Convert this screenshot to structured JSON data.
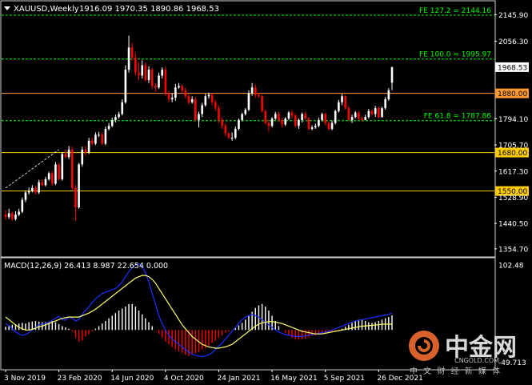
{
  "header": {
    "symbol_timeframe": "XAUUSD,Weekly",
    "ohlc": "1916.09 1970.35 1890.86 1968.53",
    "menu_icon": "triangle-down-icon"
  },
  "colors": {
    "background": "#000000",
    "bull": "#ffffff",
    "bear": "#ff0000",
    "fib": "#00ff00",
    "level_orange": "#ff9933",
    "level_yellow": "#ffcc00",
    "macd_line": "#1e2fff",
    "signal_line": "#ffff66",
    "axis": "#ffffff"
  },
  "chart_data": [
    {
      "type": "candlestick",
      "title": "XAUUSD,Weekly",
      "ylim": [
        1330,
        2190
      ],
      "y_ticks": [
        "2145.90",
        "2056.30",
        "1968.53",
        "1880.00",
        "1794.10",
        "1705.70",
        "1617.30",
        "1528.90",
        "1440.50",
        "1354.70"
      ],
      "last_price": "1968.53",
      "x_tick_labels": [
        "3 Nov 2019",
        "23 Feb 2020",
        "14 Jun 2020",
        "4 Oct 2020",
        "24 Jan 2021",
        "16 May 2021",
        "5 Sep 2021",
        "26 Dec 2021"
      ],
      "x_tick_index": [
        0,
        16,
        32,
        48,
        64,
        80,
        96,
        112
      ],
      "lines": [
        {
          "label": "FE 127.2 = 2144.16",
          "value": 2144.16,
          "style": "dashed",
          "color": "fib"
        },
        {
          "label": "FE 100.0 = 1995.97",
          "value": 1995.97,
          "style": "dashed",
          "color": "fib"
        },
        {
          "label": "FE 61.8 = 1787.86",
          "value": 1787.86,
          "style": "dashed",
          "color": "fib"
        },
        {
          "label": "1880.00",
          "value": 1880.0,
          "style": "solid",
          "color": "level_orange"
        },
        {
          "label": "1680.00",
          "value": 1680.0,
          "style": "solid",
          "color": "level_yellow"
        },
        {
          "label": "1550.00",
          "value": 1550.0,
          "style": "solid",
          "color": "level_yellow"
        }
      ],
      "fib_projection": [
        [
          0,
          1560
        ],
        [
          16,
          1690
        ]
      ],
      "close": [
        1462,
        1475,
        1455,
        1470,
        1480,
        1520,
        1545,
        1550,
        1560,
        1545,
        1580,
        1570,
        1590,
        1610,
        1575,
        1640,
        1590,
        1675,
        1665,
        1690,
        1560,
        1495,
        1640,
        1690,
        1680,
        1720,
        1710,
        1740,
        1740,
        1710,
        1760,
        1770,
        1790,
        1800,
        1810,
        1850,
        1960,
        2035,
        2000,
        1950,
        1940,
        1975,
        1925,
        1960,
        1905,
        1900,
        1940,
        1960,
        1880,
        1860,
        1865,
        1900,
        1905,
        1890,
        1870,
        1850,
        1860,
        1790,
        1810,
        1840,
        1870,
        1875,
        1850,
        1830,
        1790,
        1770,
        1745,
        1730,
        1730,
        1760,
        1790,
        1810,
        1825,
        1880,
        1900,
        1875,
        1870,
        1820,
        1780,
        1770,
        1795,
        1810,
        1790,
        1775,
        1795,
        1815,
        1805,
        1770,
        1790,
        1810,
        1795,
        1760,
        1765,
        1770,
        1790,
        1810,
        1780,
        1760,
        1780,
        1820,
        1850,
        1870,
        1830,
        1790,
        1800,
        1815,
        1795,
        1790,
        1800,
        1820,
        1810,
        1830,
        1800,
        1830,
        1860,
        1890,
        1968.53
      ],
      "open": [
        1470,
        1462,
        1475,
        1455,
        1470,
        1480,
        1520,
        1545,
        1550,
        1560,
        1545,
        1580,
        1570,
        1590,
        1610,
        1575,
        1640,
        1590,
        1675,
        1665,
        1690,
        1560,
        1495,
        1640,
        1690,
        1680,
        1720,
        1710,
        1740,
        1740,
        1710,
        1760,
        1770,
        1790,
        1800,
        1810,
        1850,
        1960,
        2035,
        2000,
        1950,
        1940,
        1975,
        1925,
        1960,
        1905,
        1900,
        1940,
        1960,
        1880,
        1860,
        1865,
        1900,
        1905,
        1890,
        1870,
        1850,
        1860,
        1790,
        1810,
        1840,
        1870,
        1875,
        1850,
        1830,
        1790,
        1770,
        1745,
        1730,
        1730,
        1760,
        1790,
        1810,
        1825,
        1880,
        1900,
        1875,
        1870,
        1820,
        1780,
        1770,
        1795,
        1810,
        1790,
        1775,
        1795,
        1815,
        1805,
        1770,
        1790,
        1810,
        1795,
        1760,
        1765,
        1770,
        1790,
        1810,
        1780,
        1760,
        1780,
        1820,
        1850,
        1870,
        1830,
        1790,
        1800,
        1815,
        1795,
        1790,
        1800,
        1820,
        1810,
        1830,
        1800,
        1830,
        1860,
        1916.09
      ],
      "high": [
        1485,
        1490,
        1480,
        1482,
        1490,
        1528,
        1552,
        1562,
        1570,
        1568,
        1588,
        1590,
        1598,
        1615,
        1618,
        1648,
        1645,
        1682,
        1690,
        1702,
        1700,
        1570,
        1645,
        1700,
        1702,
        1730,
        1730,
        1748,
        1750,
        1748,
        1768,
        1780,
        1798,
        1808,
        1818,
        1860,
        1975,
        2075,
        2050,
        2015,
        1985,
        1992,
        1985,
        1972,
        1965,
        1915,
        1950,
        1968,
        1970,
        1888,
        1880,
        1912,
        1915,
        1910,
        1898,
        1878,
        1870,
        1868,
        1818,
        1848,
        1878,
        1882,
        1880,
        1858,
        1838,
        1798,
        1778,
        1750,
        1748,
        1768,
        1795,
        1815,
        1830,
        1890,
        1915,
        1910,
        1882,
        1875,
        1825,
        1790,
        1800,
        1818,
        1818,
        1798,
        1800,
        1820,
        1822,
        1812,
        1795,
        1815,
        1818,
        1800,
        1772,
        1778,
        1798,
        1815,
        1815,
        1785,
        1788,
        1825,
        1858,
        1878,
        1875,
        1838,
        1808,
        1820,
        1820,
        1800,
        1808,
        1828,
        1825,
        1838,
        1835,
        1835,
        1868,
        1898,
        1970.35
      ],
      "low": [
        1452,
        1456,
        1448,
        1450,
        1465,
        1475,
        1512,
        1538,
        1545,
        1538,
        1540,
        1565,
        1565,
        1585,
        1568,
        1570,
        1585,
        1585,
        1660,
        1658,
        1555,
        1450,
        1490,
        1632,
        1670,
        1675,
        1705,
        1705,
        1732,
        1705,
        1705,
        1755,
        1765,
        1782,
        1795,
        1805,
        1845,
        1950,
        1990,
        1940,
        1925,
        1930,
        1920,
        1915,
        1895,
        1885,
        1895,
        1930,
        1870,
        1850,
        1850,
        1855,
        1895,
        1880,
        1862,
        1842,
        1845,
        1785,
        1765,
        1800,
        1835,
        1862,
        1840,
        1820,
        1780,
        1760,
        1735,
        1725,
        1720,
        1725,
        1755,
        1785,
        1805,
        1820,
        1872,
        1865,
        1865,
        1815,
        1775,
        1750,
        1765,
        1790,
        1785,
        1765,
        1770,
        1790,
        1795,
        1765,
        1760,
        1782,
        1790,
        1755,
        1755,
        1760,
        1765,
        1785,
        1772,
        1755,
        1755,
        1775,
        1815,
        1840,
        1825,
        1785,
        1780,
        1795,
        1790,
        1785,
        1790,
        1795,
        1805,
        1800,
        1795,
        1798,
        1825,
        1855,
        1890.86
      ]
    },
    {
      "type": "macd",
      "title": "MACD(12,26,9) 26.413 8.987 22.654 0.000",
      "y_ticks": [
        "102.48",
        "-49.713"
      ],
      "ylim": [
        -60,
        110
      ],
      "histogram": [
        5,
        6,
        8,
        9,
        10,
        11,
        10,
        12,
        13,
        14,
        13,
        12,
        12,
        13,
        14,
        12,
        9,
        6,
        4,
        2,
        -2,
        -12,
        -18,
        -16,
        -10,
        -6,
        -2,
        2,
        6,
        10,
        14,
        18,
        22,
        26,
        30,
        33,
        36,
        40,
        40,
        36,
        30,
        24,
        18,
        12,
        6,
        0,
        -6,
        -12,
        -18,
        -22,
        -26,
        -30,
        -33,
        -35,
        -38,
        -40,
        -38,
        -36,
        -34,
        -30,
        -28,
        -24,
        -20,
        -16,
        -12,
        -8,
        -4,
        -2,
        0,
        3,
        7,
        11,
        16,
        22,
        28,
        34,
        38,
        40,
        36,
        30,
        22,
        14,
        6,
        0,
        -4,
        -8,
        -12,
        -14,
        -15,
        -14,
        -13,
        -11,
        -9,
        -8,
        -7,
        -6,
        -5,
        -4,
        -3,
        -2,
        0,
        2,
        5,
        8,
        11,
        14,
        16,
        16,
        14,
        12,
        11,
        12,
        14,
        16,
        18,
        20,
        22.654
      ],
      "macd": [
        10,
        7,
        2,
        -3,
        -6,
        -8,
        -7,
        -4,
        0,
        4,
        8,
        9,
        10,
        12,
        15,
        18,
        21,
        16,
        15,
        20,
        18,
        14,
        16,
        24,
        30,
        36,
        42,
        48,
        52,
        56,
        58,
        60,
        62,
        64,
        68,
        74,
        82,
        90,
        96,
        100,
        102,
        98,
        88,
        74,
        56,
        40,
        22,
        10,
        0,
        -8,
        -14,
        -18,
        -22,
        -26,
        -30,
        -34,
        -37,
        -39,
        -40,
        -41,
        -40,
        -38,
        -35,
        -30,
        -25,
        -20,
        -14,
        -8,
        -2,
        4,
        10,
        16,
        20,
        22,
        24,
        22,
        20,
        16,
        12,
        8,
        4,
        0,
        -3,
        -5,
        -7,
        -8,
        -9,
        -10,
        -10,
        -10,
        -9,
        -8,
        -7,
        -6,
        -5,
        -4,
        -3,
        -2,
        0,
        2,
        4,
        6,
        8,
        10,
        12,
        14,
        15,
        16,
        17,
        18,
        19,
        20,
        21,
        22,
        23,
        24,
        26.413
      ],
      "signal": [
        20,
        16,
        12,
        8,
        4,
        2,
        0,
        0,
        1,
        3,
        5,
        6,
        8,
        10,
        12,
        14,
        16,
        18,
        19,
        20,
        20,
        20,
        20,
        22,
        24,
        26,
        29,
        32,
        36,
        40,
        44,
        48,
        52,
        56,
        60,
        64,
        68,
        72,
        76,
        80,
        82,
        84,
        84,
        82,
        78,
        72,
        64,
        56,
        48,
        40,
        32,
        24,
        16,
        8,
        2,
        -4,
        -10,
        -14,
        -18,
        -22,
        -24,
        -26,
        -27,
        -28,
        -28,
        -27,
        -26,
        -24,
        -22,
        -18,
        -14,
        -10,
        -6,
        -2,
        2,
        6,
        9,
        11,
        12,
        13,
        13,
        12,
        11,
        10,
        8,
        6,
        4,
        2,
        0,
        -2,
        -3,
        -4,
        -5,
        -6,
        -6,
        -6,
        -5,
        -4,
        -3,
        -2,
        -1,
        0,
        1,
        2,
        3,
        4,
        5,
        6,
        6,
        7,
        7,
        8,
        8,
        9,
        9,
        9,
        8.987
      ]
    }
  ],
  "watermark": {
    "brand": "中金网",
    "site": "CNGOLD.COM",
    "tagline": "中 文 财 经 新 媒 体"
  }
}
